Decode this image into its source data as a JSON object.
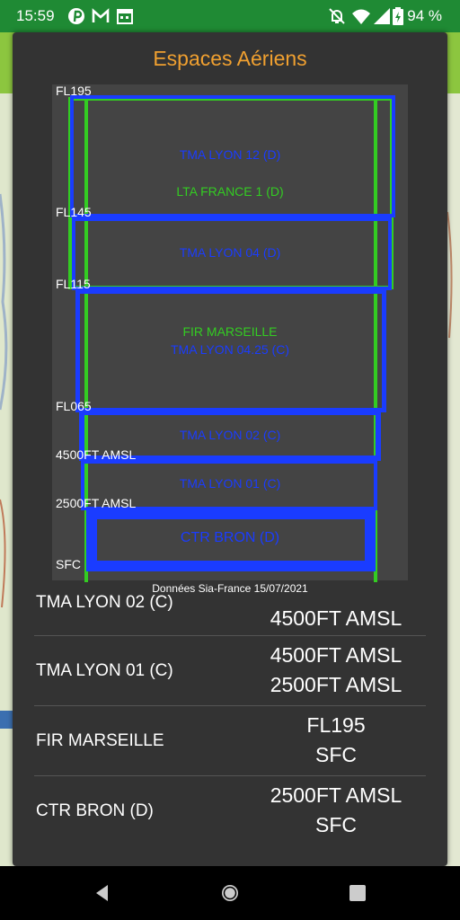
{
  "status_bar": {
    "time": "15:59",
    "icons": [
      "pinterest-icon",
      "gmail-icon",
      "calendar-icon",
      "dnd-off-icon",
      "wifi-icon",
      "signal-icon",
      "battery-charging-icon"
    ],
    "battery": "94 %",
    "color": "#1f8a34"
  },
  "dialog": {
    "title": "Espaces Aériens",
    "title_color": "#f0a030",
    "diagram": {
      "levels": [
        "FL195",
        "FL145",
        "FL115",
        "FL065",
        "4500FT AMSL",
        "2500FT AMSL",
        "SFC"
      ],
      "labels": {
        "tma_lyon_12": "TMA LYON 12 (D)",
        "lta_france_1": "LTA FRANCE 1 (D)",
        "tma_lyon_04": "TMA LYON 04 (D)",
        "fir_marseille": "FIR MARSEILLE",
        "tma_lyon_0425": "TMA LYON 04.25 (C)",
        "tma_lyon_02": "TMA LYON 02 (C)",
        "tma_lyon_01": "TMA LYON 01 (C)",
        "ctr_bron": "CTR BRON (D)"
      },
      "colors": {
        "class_d_c": "#1a3cff",
        "lta_fir": "#33cc22",
        "background": "#444444"
      }
    },
    "source_note": "Données Sia-France 15/07/2021",
    "airspaces": [
      {
        "name": "TMA LYON 02 (C)",
        "upper": "",
        "lower": "4500FT AMSL"
      },
      {
        "name": "TMA LYON 01 (C)",
        "upper": "4500FT AMSL",
        "lower": "2500FT AMSL"
      },
      {
        "name": "FIR MARSEILLE",
        "upper": "FL195",
        "lower": "SFC"
      },
      {
        "name": "CTR BRON (D)",
        "upper": "2500FT AMSL",
        "lower": "SFC"
      }
    ]
  },
  "nav_bar": {
    "buttons": [
      "back-icon",
      "home-icon",
      "recents-icon"
    ]
  }
}
